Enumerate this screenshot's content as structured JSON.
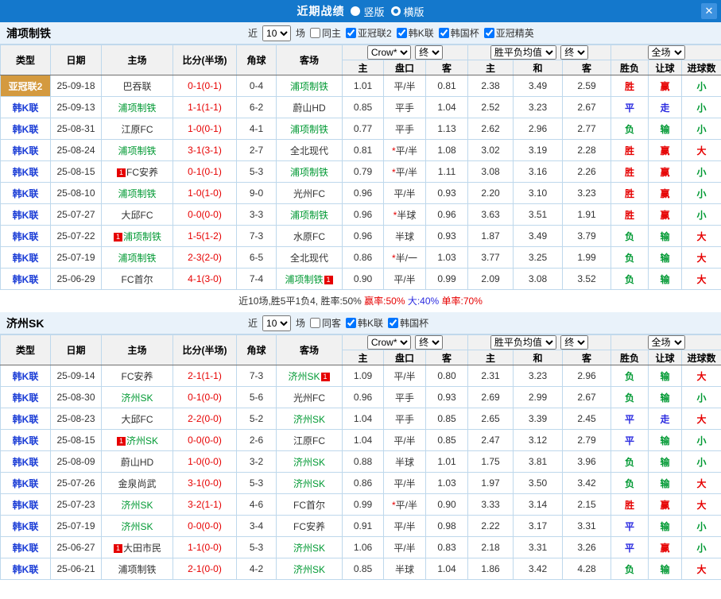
{
  "topbar": {
    "title": "近期战绩",
    "radio_vertical": "竖版",
    "radio_horizontal": "横版",
    "selected": "横版",
    "close_glyph": "✕"
  },
  "table_header": {
    "type": "类型",
    "date": "日期",
    "home": "主场",
    "score": "比分(半场)",
    "corner": "角球",
    "away": "客场",
    "odds_source": "Crow*",
    "odds_final": "终",
    "avg_source": "胜平负均值",
    "avg_final": "终",
    "scope": "全场",
    "sub": [
      "主",
      "盘口",
      "客",
      "主",
      "和",
      "客",
      "胜负",
      "让球",
      "进球数"
    ]
  },
  "sections": [
    {
      "team": "浦项制铁",
      "filter": {
        "near": "近",
        "count": "10",
        "unit": "场",
        "checkboxes": [
          {
            "label": "同主",
            "checked": false
          },
          {
            "label": "亚冠联2",
            "checked": true
          },
          {
            "label": "韩K联",
            "checked": true
          },
          {
            "label": "韩国杯",
            "checked": true
          },
          {
            "label": "亚冠精英",
            "checked": true
          }
        ]
      },
      "rows": [
        {
          "league": "亚冠联2",
          "acl": true,
          "date": "25-09-18",
          "home": "巴吞联",
          "hg": false,
          "hb": "",
          "score": "0-1(0-1)",
          "corner": "0-4",
          "away": "浦项制铁",
          "ag": true,
          "ab": "",
          "o1": "1.01",
          "star": false,
          "hc": "平/半",
          "o2": "0.81",
          "a1": "2.38",
          "a2": "3.49",
          "a3": "2.59",
          "res": "胜",
          "resc": "r",
          "let": "赢",
          "letc": "r",
          "goal": "小",
          "goalc": "g"
        },
        {
          "league": "韩K联",
          "acl": false,
          "date": "25-09-13",
          "home": "浦项制铁",
          "hg": true,
          "hb": "",
          "score": "1-1(1-1)",
          "corner": "6-2",
          "away": "蔚山HD",
          "ag": false,
          "ab": "",
          "o1": "0.85",
          "star": false,
          "hc": "平手",
          "o2": "1.04",
          "a1": "2.52",
          "a2": "3.23",
          "a3": "2.67",
          "res": "平",
          "resc": "b",
          "let": "走",
          "letc": "b",
          "goal": "小",
          "goalc": "g"
        },
        {
          "league": "韩K联",
          "acl": false,
          "date": "25-08-31",
          "home": "江原FC",
          "hg": false,
          "hb": "",
          "score": "1-0(0-1)",
          "corner": "4-1",
          "away": "浦项制铁",
          "ag": true,
          "ab": "",
          "o1": "0.77",
          "star": false,
          "hc": "平手",
          "o2": "1.13",
          "a1": "2.62",
          "a2": "2.96",
          "a3": "2.77",
          "res": "负",
          "resc": "g",
          "let": "输",
          "letc": "g",
          "goal": "小",
          "goalc": "g"
        },
        {
          "league": "韩K联",
          "acl": false,
          "date": "25-08-24",
          "home": "浦项制铁",
          "hg": true,
          "hb": "",
          "score": "3-1(3-1)",
          "corner": "2-7",
          "away": "全北现代",
          "ag": false,
          "ab": "",
          "o1": "0.81",
          "star": true,
          "hc": "平/半",
          "o2": "1.08",
          "a1": "3.02",
          "a2": "3.19",
          "a3": "2.28",
          "res": "胜",
          "resc": "r",
          "let": "赢",
          "letc": "r",
          "goal": "大",
          "goalc": "r"
        },
        {
          "league": "韩K联",
          "acl": false,
          "date": "25-08-15",
          "home": "FC安养",
          "hg": false,
          "hb": "pre",
          "score": "0-1(0-1)",
          "corner": "5-3",
          "away": "浦项制铁",
          "ag": true,
          "ab": "",
          "o1": "0.79",
          "star": true,
          "hc": "平/半",
          "o2": "1.11",
          "a1": "3.08",
          "a2": "3.16",
          "a3": "2.26",
          "res": "胜",
          "resc": "r",
          "let": "赢",
          "letc": "r",
          "goal": "小",
          "goalc": "g"
        },
        {
          "league": "韩K联",
          "acl": false,
          "date": "25-08-10",
          "home": "浦项制铁",
          "hg": true,
          "hb": "",
          "score": "1-0(1-0)",
          "corner": "9-0",
          "away": "光州FC",
          "ag": false,
          "ab": "",
          "o1": "0.96",
          "star": false,
          "hc": "平/半",
          "o2": "0.93",
          "a1": "2.20",
          "a2": "3.10",
          "a3": "3.23",
          "res": "胜",
          "resc": "r",
          "let": "赢",
          "letc": "r",
          "goal": "小",
          "goalc": "g"
        },
        {
          "league": "韩K联",
          "acl": false,
          "date": "25-07-27",
          "home": "大邱FC",
          "hg": false,
          "hb": "",
          "score": "0-0(0-0)",
          "corner": "3-3",
          "away": "浦项制铁",
          "ag": true,
          "ab": "",
          "o1": "0.96",
          "star": true,
          "hc": "半球",
          "o2": "0.96",
          "a1": "3.63",
          "a2": "3.51",
          "a3": "1.91",
          "res": "胜",
          "resc": "r",
          "let": "赢",
          "letc": "r",
          "goal": "小",
          "goalc": "g"
        },
        {
          "league": "韩K联",
          "acl": false,
          "date": "25-07-22",
          "home": "浦项制铁",
          "hg": true,
          "hb": "pre",
          "score": "1-5(1-2)",
          "corner": "7-3",
          "away": "水原FC",
          "ag": false,
          "ab": "",
          "o1": "0.96",
          "star": false,
          "hc": "半球",
          "o2": "0.93",
          "a1": "1.87",
          "a2": "3.49",
          "a3": "3.79",
          "res": "负",
          "resc": "g",
          "let": "输",
          "letc": "g",
          "goal": "大",
          "goalc": "r"
        },
        {
          "league": "韩K联",
          "acl": false,
          "date": "25-07-19",
          "home": "浦项制铁",
          "hg": true,
          "hb": "",
          "score": "2-3(2-0)",
          "corner": "6-5",
          "away": "全北现代",
          "ag": false,
          "ab": "",
          "o1": "0.86",
          "star": true,
          "hc": "半/一",
          "o2": "1.03",
          "a1": "3.77",
          "a2": "3.25",
          "a3": "1.99",
          "res": "负",
          "resc": "g",
          "let": "输",
          "letc": "g",
          "goal": "大",
          "goalc": "r"
        },
        {
          "league": "韩K联",
          "acl": false,
          "date": "25-06-29",
          "home": "FC首尔",
          "hg": false,
          "hb": "",
          "score": "4-1(3-0)",
          "corner": "7-4",
          "away": "浦项制铁",
          "ag": true,
          "ab": "post",
          "o1": "0.90",
          "star": false,
          "hc": "平/半",
          "o2": "0.99",
          "a1": "2.09",
          "a2": "3.08",
          "a3": "3.52",
          "res": "负",
          "resc": "g",
          "let": "输",
          "letc": "g",
          "goal": "大",
          "goalc": "r"
        }
      ],
      "summary": [
        {
          "t": "近10场,胜5平1负4, 胜率:50% ",
          "c": "k"
        },
        {
          "t": "赢率:50% ",
          "c": "r"
        },
        {
          "t": "大:40% ",
          "c": "b"
        },
        {
          "t": "单率:70%",
          "c": "r"
        }
      ]
    },
    {
      "team": "济州SK",
      "filter": {
        "near": "近",
        "count": "10",
        "unit": "场",
        "checkboxes": [
          {
            "label": "同客",
            "checked": false
          },
          {
            "label": "韩K联",
            "checked": true
          },
          {
            "label": "韩国杯",
            "checked": true
          }
        ]
      },
      "rows": [
        {
          "league": "韩K联",
          "acl": false,
          "date": "25-09-14",
          "home": "FC安养",
          "hg": false,
          "hb": "",
          "score": "2-1(1-1)",
          "corner": "7-3",
          "away": "济州SK",
          "ag": true,
          "ab": "post",
          "o1": "1.09",
          "star": false,
          "hc": "平/半",
          "o2": "0.80",
          "a1": "2.31",
          "a2": "3.23",
          "a3": "2.96",
          "res": "负",
          "resc": "g",
          "let": "输",
          "letc": "g",
          "goal": "大",
          "goalc": "r"
        },
        {
          "league": "韩K联",
          "acl": false,
          "date": "25-08-30",
          "home": "济州SK",
          "hg": true,
          "hb": "",
          "score": "0-1(0-0)",
          "corner": "5-6",
          "away": "光州FC",
          "ag": false,
          "ab": "",
          "o1": "0.96",
          "star": false,
          "hc": "平手",
          "o2": "0.93",
          "a1": "2.69",
          "a2": "2.99",
          "a3": "2.67",
          "res": "负",
          "resc": "g",
          "let": "输",
          "letc": "g",
          "goal": "小",
          "goalc": "g"
        },
        {
          "league": "韩K联",
          "acl": false,
          "date": "25-08-23",
          "home": "大邱FC",
          "hg": false,
          "hb": "",
          "score": "2-2(0-0)",
          "corner": "5-2",
          "away": "济州SK",
          "ag": true,
          "ab": "",
          "o1": "1.04",
          "star": false,
          "hc": "平手",
          "o2": "0.85",
          "a1": "2.65",
          "a2": "3.39",
          "a3": "2.45",
          "res": "平",
          "resc": "b",
          "let": "走",
          "letc": "b",
          "goal": "大",
          "goalc": "r"
        },
        {
          "league": "韩K联",
          "acl": false,
          "date": "25-08-15",
          "home": "济州SK",
          "hg": true,
          "hb": "pre",
          "score": "0-0(0-0)",
          "corner": "2-6",
          "away": "江原FC",
          "ag": false,
          "ab": "",
          "o1": "1.04",
          "star": false,
          "hc": "平/半",
          "o2": "0.85",
          "a1": "2.47",
          "a2": "3.12",
          "a3": "2.79",
          "res": "平",
          "resc": "b",
          "let": "输",
          "letc": "g",
          "goal": "小",
          "goalc": "g"
        },
        {
          "league": "韩K联",
          "acl": false,
          "date": "25-08-09",
          "home": "蔚山HD",
          "hg": false,
          "hb": "",
          "score": "1-0(0-0)",
          "corner": "3-2",
          "away": "济州SK",
          "ag": true,
          "ab": "",
          "o1": "0.88",
          "star": false,
          "hc": "半球",
          "o2": "1.01",
          "a1": "1.75",
          "a2": "3.81",
          "a3": "3.96",
          "res": "负",
          "resc": "g",
          "let": "输",
          "letc": "g",
          "goal": "小",
          "goalc": "g"
        },
        {
          "league": "韩K联",
          "acl": false,
          "date": "25-07-26",
          "home": "金泉尚武",
          "hg": false,
          "hb": "",
          "score": "3-1(0-0)",
          "corner": "5-3",
          "away": "济州SK",
          "ag": true,
          "ab": "",
          "o1": "0.86",
          "star": false,
          "hc": "平/半",
          "o2": "1.03",
          "a1": "1.97",
          "a2": "3.50",
          "a3": "3.42",
          "res": "负",
          "resc": "g",
          "let": "输",
          "letc": "g",
          "goal": "大",
          "goalc": "r"
        },
        {
          "league": "韩K联",
          "acl": false,
          "date": "25-07-23",
          "home": "济州SK",
          "hg": true,
          "hb": "",
          "score": "3-2(1-1)",
          "corner": "4-6",
          "away": "FC首尔",
          "ag": false,
          "ab": "",
          "o1": "0.99",
          "star": true,
          "hc": "平/半",
          "o2": "0.90",
          "a1": "3.33",
          "a2": "3.14",
          "a3": "2.15",
          "res": "胜",
          "resc": "r",
          "let": "赢",
          "letc": "r",
          "goal": "大",
          "goalc": "r"
        },
        {
          "league": "韩K联",
          "acl": false,
          "date": "25-07-19",
          "home": "济州SK",
          "hg": true,
          "hb": "",
          "score": "0-0(0-0)",
          "corner": "3-4",
          "away": "FC安养",
          "ag": false,
          "ab": "",
          "o1": "0.91",
          "star": false,
          "hc": "平/半",
          "o2": "0.98",
          "a1": "2.22",
          "a2": "3.17",
          "a3": "3.31",
          "res": "平",
          "resc": "b",
          "let": "输",
          "letc": "g",
          "goal": "小",
          "goalc": "g"
        },
        {
          "league": "韩K联",
          "acl": false,
          "date": "25-06-27",
          "home": "大田市民",
          "hg": false,
          "hb": "pre",
          "score": "1-1(0-0)",
          "corner": "5-3",
          "away": "济州SK",
          "ag": true,
          "ab": "",
          "o1": "1.06",
          "star": false,
          "hc": "平/半",
          "o2": "0.83",
          "a1": "2.18",
          "a2": "3.31",
          "a3": "3.26",
          "res": "平",
          "resc": "b",
          "let": "赢",
          "letc": "r",
          "goal": "小",
          "goalc": "g"
        },
        {
          "league": "韩K联",
          "acl": false,
          "date": "25-06-21",
          "home": "浦项制铁",
          "hg": false,
          "hb": "",
          "score": "2-1(0-0)",
          "corner": "4-2",
          "away": "济州SK",
          "ag": true,
          "ab": "",
          "o1": "0.85",
          "star": false,
          "hc": "半球",
          "o2": "1.04",
          "a1": "1.86",
          "a2": "3.42",
          "a3": "4.28",
          "res": "负",
          "resc": "g",
          "let": "输",
          "letc": "g",
          "goal": "大",
          "goalc": "r"
        }
      ]
    }
  ]
}
